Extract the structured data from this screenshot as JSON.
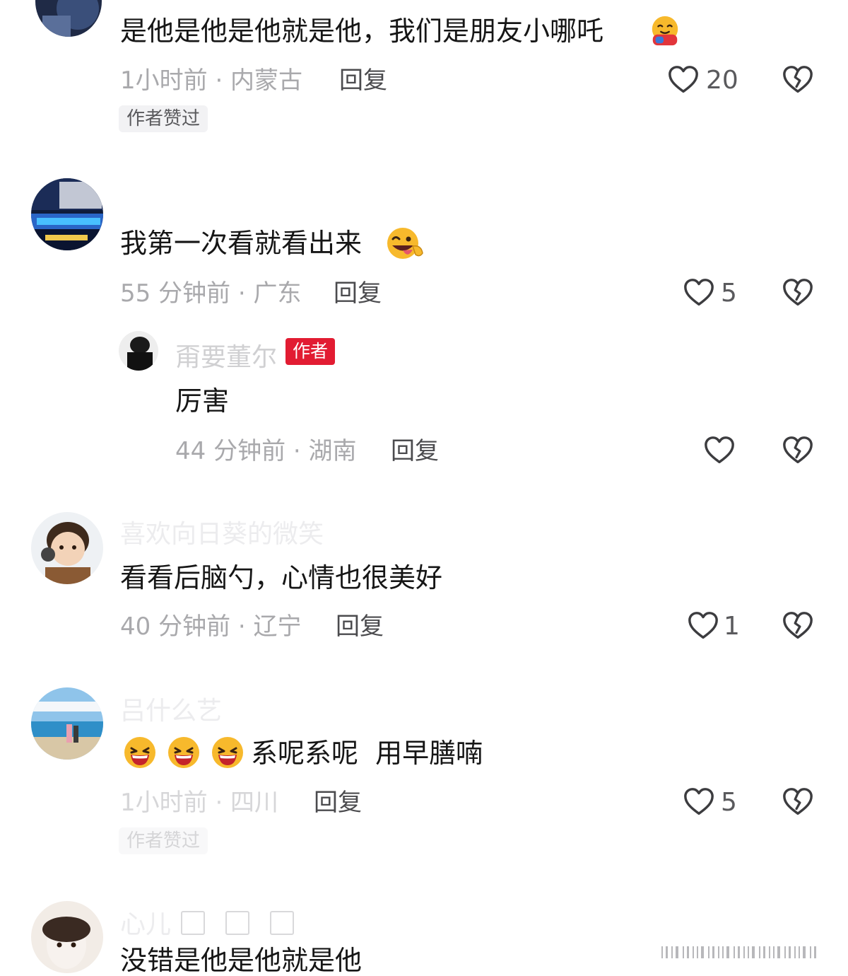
{
  "comments": [
    {
      "text": "是他是他是他就是他，我们是朋友小哪吒",
      "meta": "1小时前 · 内蒙古",
      "reply_label": "回复",
      "likes": "20",
      "tag": "作者赞过"
    },
    {
      "text": "我第一次看就看出来",
      "meta": "55 分钟前 · 广东",
      "reply_label": "回复",
      "likes": "5",
      "sub_reply": {
        "username": "甭要董尔",
        "badge": "作者",
        "text": "厉害",
        "meta": "44 分钟前 · 湖南",
        "reply_label": "回复"
      }
    },
    {
      "username": "喜欢向日葵的微笑",
      "text": "看看后脑勺，心情也很美好",
      "meta": "40 分钟前 · 辽宁",
      "reply_label": "回复",
      "likes": "1"
    },
    {
      "username": "吕什么艺",
      "text": "系呢系呢  用早膳喃",
      "meta": "1小时前 · 四川",
      "reply_label": "回复",
      "likes": "5",
      "tag": "作者赞过"
    },
    {
      "username": "心儿",
      "text": "没错是他是他就是他"
    }
  ],
  "icons": {
    "like": "heart-outline-icon",
    "dislike": "broken-heart-icon",
    "emoji_hug": "hugging-face-emoji",
    "emoji_wink": "winking-tongue-emoji",
    "emoji_laugh": "laughing-face-emoji"
  },
  "colors": {
    "author_badge": "#e21c32",
    "meta_text": "#a9a9ac",
    "body_text": "#161616"
  }
}
